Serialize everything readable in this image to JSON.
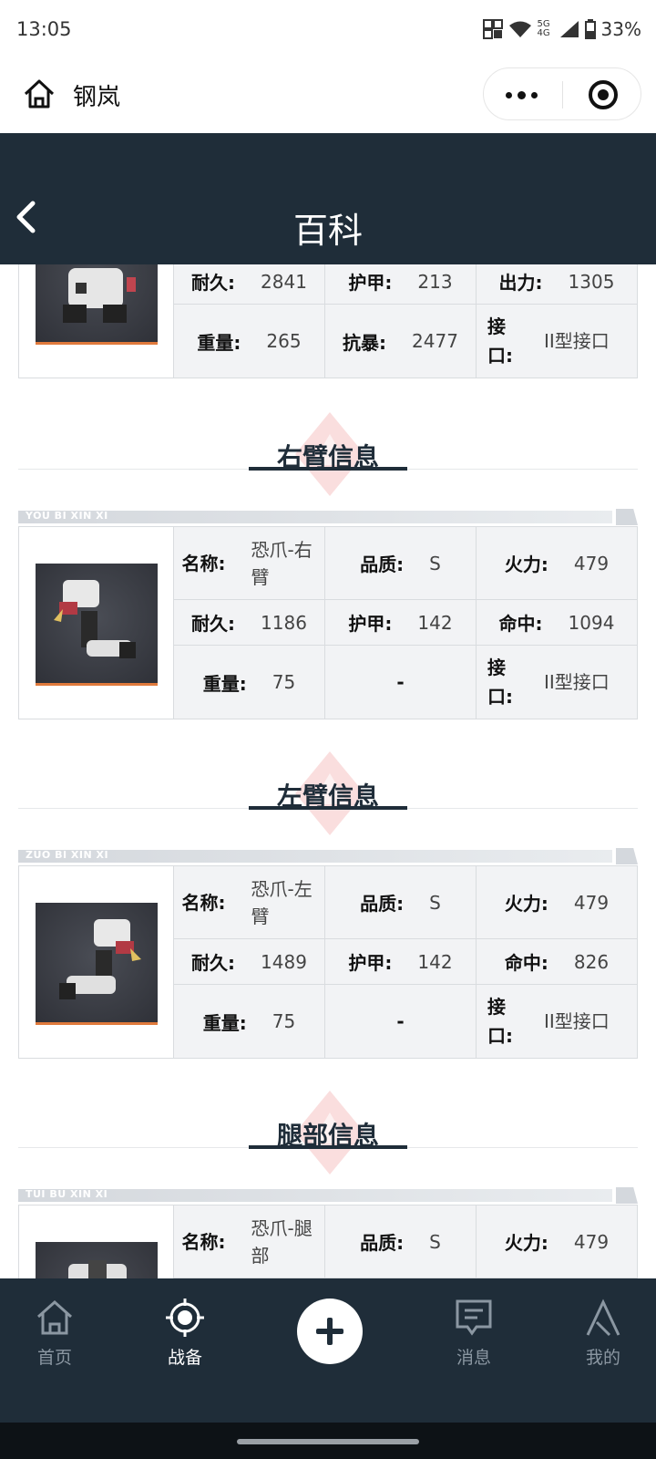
{
  "status_bar": {
    "time": "13:05",
    "network": "5G 4G",
    "battery": "33%"
  },
  "mini_program": {
    "title": "钢岚"
  },
  "page": {
    "title": "百科"
  },
  "top_partial_card": {
    "row2": [
      {
        "label": "耐久:",
        "value": "2841"
      },
      {
        "label": "护甲:",
        "value": "213"
      },
      {
        "label": "出力:",
        "value": "1305"
      }
    ],
    "row3": [
      {
        "label": "重量:",
        "value": "265"
      },
      {
        "label": "抗暴:",
        "value": "2477"
      },
      {
        "label": "接口:",
        "value": "II型接口"
      }
    ]
  },
  "sections": [
    {
      "title": "右臂信息",
      "ribbon": "YOU BI XIN XI",
      "row1": [
        {
          "label": "名称:",
          "value": "恐爪-右臂"
        },
        {
          "label": "品质:",
          "value": "S"
        },
        {
          "label": "火力:",
          "value": "479"
        }
      ],
      "row2": [
        {
          "label": "耐久:",
          "value": "1186"
        },
        {
          "label": "护甲:",
          "value": "142"
        },
        {
          "label": "命中:",
          "value": "1094"
        }
      ],
      "row3": [
        {
          "label": "重量:",
          "value": "75"
        },
        {
          "label": "",
          "value": "-"
        },
        {
          "label": "接口:",
          "value": "II型接口"
        }
      ]
    },
    {
      "title": "左臂信息",
      "ribbon": "ZUO BI XIN XI",
      "row1": [
        {
          "label": "名称:",
          "value": "恐爪-左臂"
        },
        {
          "label": "品质:",
          "value": "S"
        },
        {
          "label": "火力:",
          "value": "479"
        }
      ],
      "row2": [
        {
          "label": "耐久:",
          "value": "1489"
        },
        {
          "label": "护甲:",
          "value": "142"
        },
        {
          "label": "命中:",
          "value": "826"
        }
      ],
      "row3": [
        {
          "label": "重量:",
          "value": "75"
        },
        {
          "label": "",
          "value": "-"
        },
        {
          "label": "接口:",
          "value": "II型接口"
        }
      ]
    },
    {
      "title": "腿部信息",
      "ribbon": "TUI BU XIN XI",
      "row1": [
        {
          "label": "名称:",
          "value": "恐爪-腿部"
        },
        {
          "label": "品质:",
          "value": "S"
        },
        {
          "label": "火力:",
          "value": "479"
        }
      ]
    }
  ],
  "bottom_nav": {
    "items": [
      {
        "label": "首页",
        "icon": "home-icon"
      },
      {
        "label": "战备",
        "icon": "crosshair-icon"
      },
      {
        "label": "",
        "icon": "plus-icon"
      },
      {
        "label": "消息",
        "icon": "message-icon"
      },
      {
        "label": "我的",
        "icon": "profile-icon"
      }
    ]
  }
}
